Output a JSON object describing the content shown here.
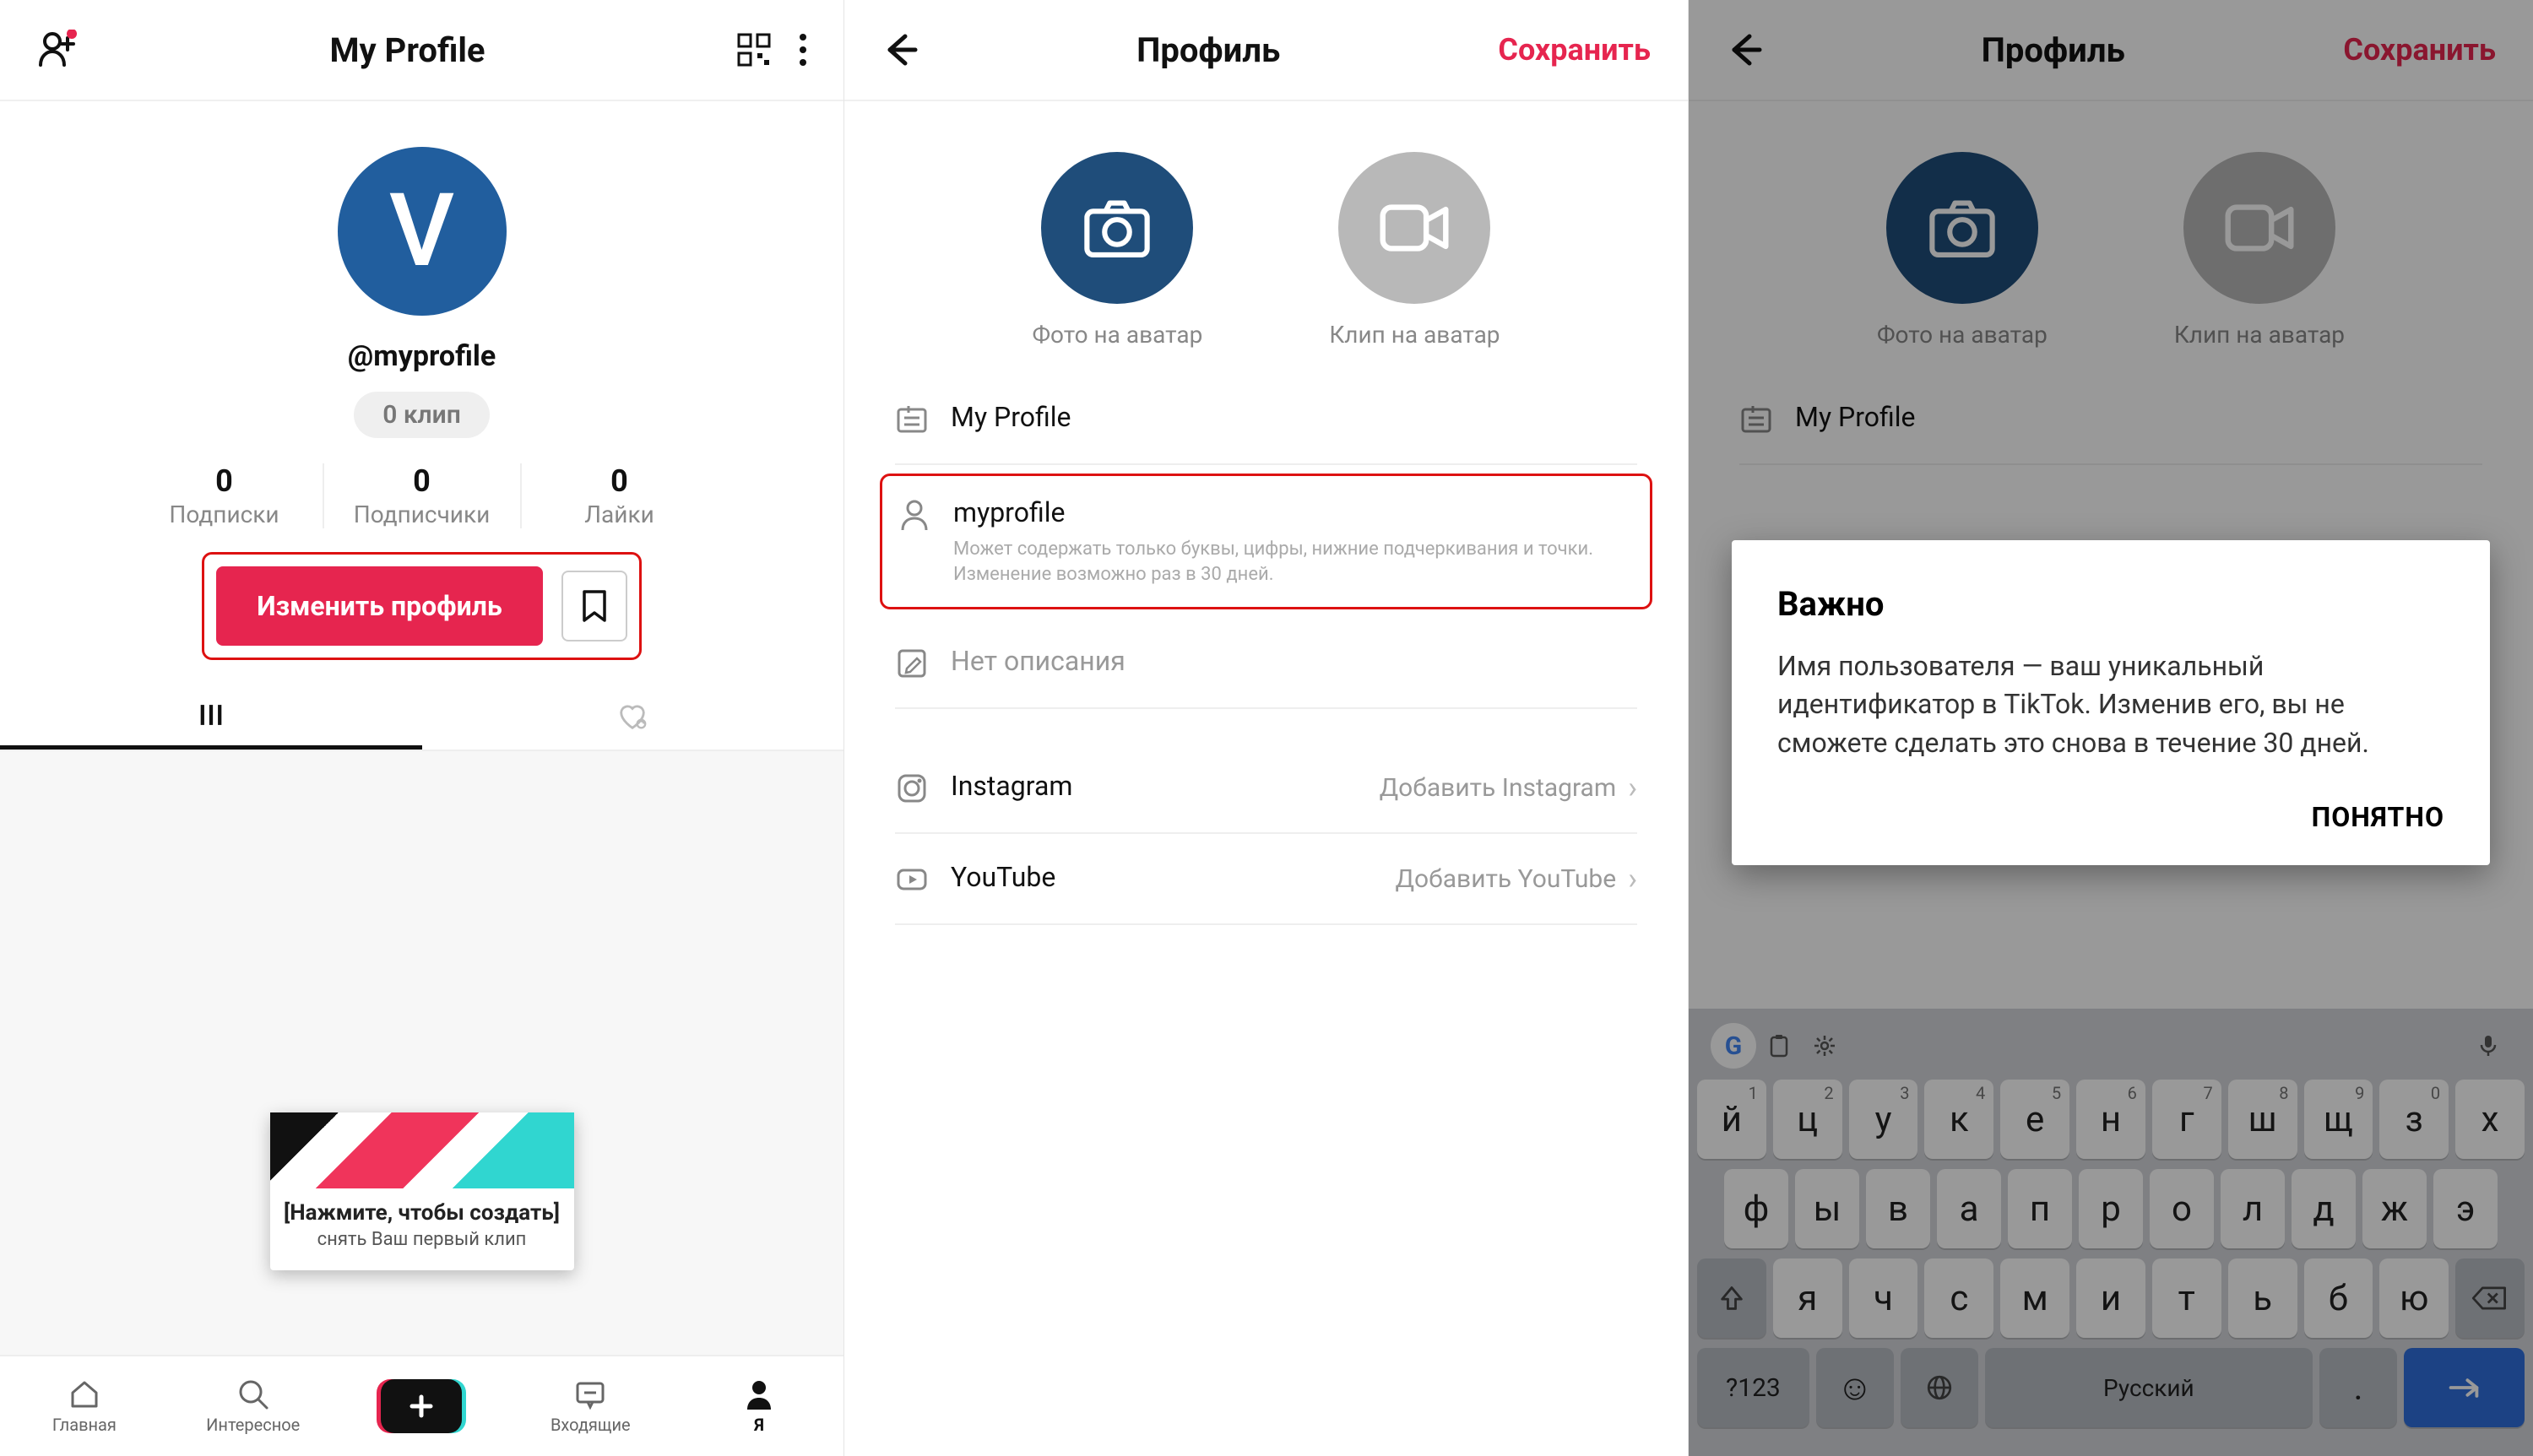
{
  "panel1": {
    "header_title": "My Profile",
    "avatar_letter": "V",
    "username": "@myprofile",
    "clip_pill": "0 клип",
    "stats": [
      {
        "num": "0",
        "label": "Подписки"
      },
      {
        "num": "0",
        "label": "Подписчики"
      },
      {
        "num": "0",
        "label": "Лайки"
      }
    ],
    "edit_profile": "Изменить профиль",
    "tooltip_l1": "[Нажмите, чтобы создать]",
    "tooltip_l2": "снять Ваш первый клип",
    "nav": {
      "home": "Главная",
      "discover": "Интересное",
      "inbox": "Входящие",
      "me": "Я"
    }
  },
  "panel2": {
    "title": "Профиль",
    "save": "Сохранить",
    "avatar_photo": "Фото на аватар",
    "avatar_clip": "Клип на аватар",
    "display_name": "My Profile",
    "username": "myprofile",
    "username_hint": "Может содержать только буквы, цифры, нижние подчеркивания и точки. Изменение возможно раз в 30 дней.",
    "bio_placeholder": "Нет описания",
    "instagram_label": "Instagram",
    "instagram_action": "Добавить Instagram",
    "youtube_label": "YouTube",
    "youtube_action": "Добавить YouTube"
  },
  "panel3": {
    "title": "Профиль",
    "save": "Сохранить",
    "avatar_photo": "Фото на аватар",
    "avatar_clip": "Клип на аватар",
    "display_name": "My Profile",
    "dialog_title": "Важно",
    "dialog_body": "Имя пользователя — ваш уникальный идентификатор в TikTok. Изменив его, вы не сможете сделать это снова в течение 30 дней.",
    "dialog_ok": "ПОНЯТНО",
    "keyboard": {
      "row1": [
        {
          "k": "й",
          "n": "1"
        },
        {
          "k": "ц",
          "n": "2"
        },
        {
          "k": "у",
          "n": "3"
        },
        {
          "k": "к",
          "n": "4"
        },
        {
          "k": "е",
          "n": "5"
        },
        {
          "k": "н",
          "n": "6"
        },
        {
          "k": "г",
          "n": "7"
        },
        {
          "k": "ш",
          "n": "8"
        },
        {
          "k": "щ",
          "n": "9"
        },
        {
          "k": "з",
          "n": "0"
        },
        {
          "k": "х",
          "n": ""
        }
      ],
      "row2": [
        "ф",
        "ы",
        "в",
        "а",
        "п",
        "р",
        "о",
        "л",
        "д",
        "ж",
        "э"
      ],
      "row3": [
        "я",
        "ч",
        "с",
        "м",
        "и",
        "т",
        "ь",
        "б",
        "ю"
      ],
      "mode": "?123",
      "lang": "Русский"
    }
  }
}
